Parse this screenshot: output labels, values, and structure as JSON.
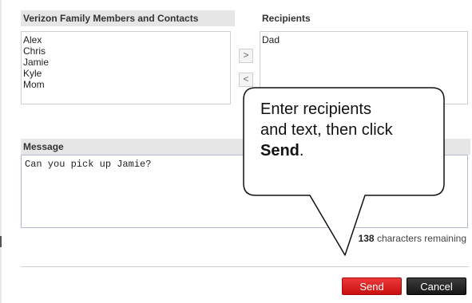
{
  "contacts": {
    "header": "Verizon Family Members and Contacts",
    "items": [
      "Alex",
      "Chris",
      "Jamie",
      "Kyle",
      "Mom"
    ]
  },
  "recipients": {
    "header": "Recipients",
    "items": [
      "Dad"
    ]
  },
  "move_buttons": {
    "add": ">",
    "remove": "<"
  },
  "message": {
    "header": "Message",
    "value": "Can you pick up Jamie?"
  },
  "char_count": {
    "number": "138",
    "suffix": " characters remaining"
  },
  "buttons": {
    "send": "Send",
    "cancel": "Cancel"
  },
  "callout": {
    "line1": "Enter recipients",
    "line2": "and text, then click",
    "emphasis": "Send",
    "end": "."
  },
  "colors": {
    "send_button": "#d91e1e",
    "cancel_button": "#2a2a2a",
    "header_bar": "#e6e6e6"
  }
}
